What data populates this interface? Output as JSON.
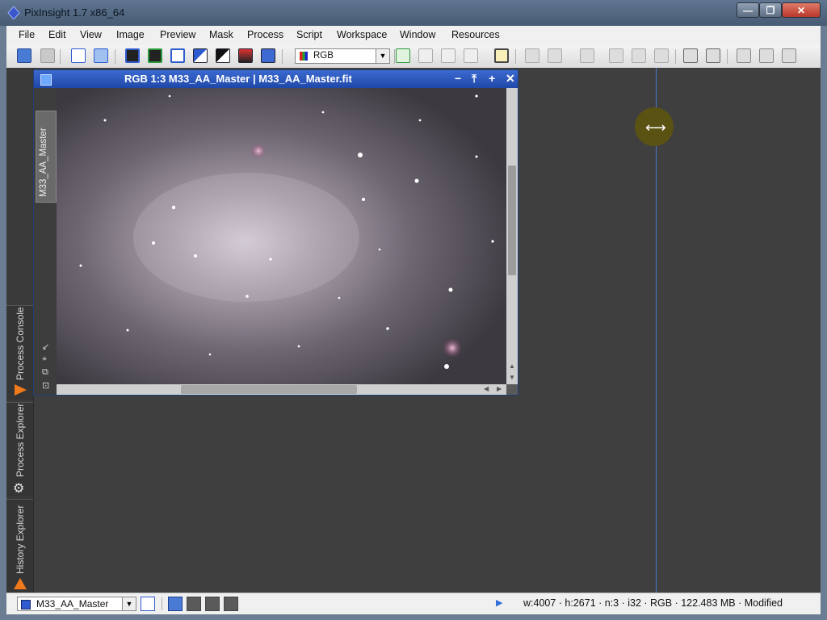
{
  "app": {
    "title": "PixInsight 1.7 x86_64",
    "window_buttons": {
      "minimize": "—",
      "maximize": "❐",
      "close": "✕"
    }
  },
  "menubar": {
    "items": [
      "File",
      "Edit",
      "View",
      "Image",
      "Preview",
      "Mask",
      "Process",
      "Script",
      "Workspace",
      "Window",
      "Resources"
    ]
  },
  "toolbar": {
    "channel_combo": "RGB"
  },
  "sidebar": {
    "tabs": [
      {
        "label": "Process Console",
        "icon": "orange-triangle-icon"
      },
      {
        "label": "Process Explorer",
        "icon": "gear-icon"
      },
      {
        "label": "History Explorer",
        "icon": "orange-triangle-icon"
      }
    ]
  },
  "image_window": {
    "caption": "RGB 1:3 M33_AA_Master | M33_AA_Master.fit",
    "tab_label": "M33_AA_Master",
    "buttons": {
      "shade": "−",
      "maximize": "⤒",
      "restore": "+",
      "close": "✕"
    }
  },
  "statusbar": {
    "view_selector": "M33_AA_Master",
    "info": "w:4007 · h:2671 · n:3 · i32 · RGB · 122.483 MB · Modified"
  },
  "colors": {
    "accent": "#1f48a8",
    "workspace": "#3f3f3f",
    "guide": "#4a78c8"
  }
}
